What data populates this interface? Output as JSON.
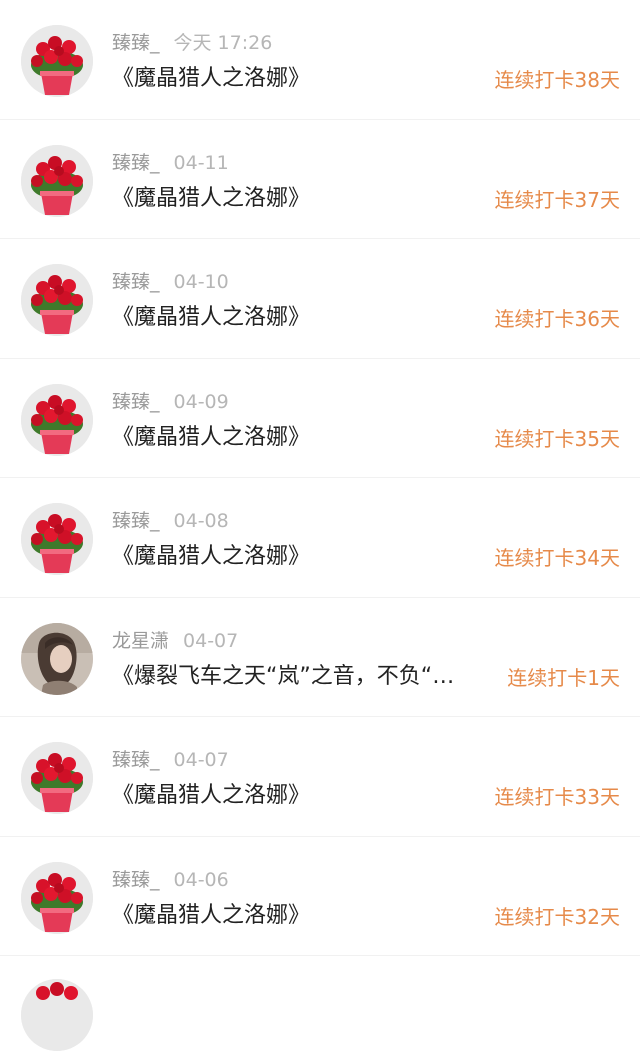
{
  "feed": {
    "items": [
      {
        "avatar": "red-flower-pot",
        "name": "臻臻_",
        "time": "今天 17:26",
        "title": "《魔晶猎人之洛娜》",
        "streak": "连续打卡38天"
      },
      {
        "avatar": "red-flower-pot",
        "name": "臻臻_",
        "time": "04-11",
        "title": "《魔晶猎人之洛娜》",
        "streak": "连续打卡37天"
      },
      {
        "avatar": "red-flower-pot",
        "name": "臻臻_",
        "time": "04-10",
        "title": "《魔晶猎人之洛娜》",
        "streak": "连续打卡36天"
      },
      {
        "avatar": "red-flower-pot",
        "name": "臻臻_",
        "time": "04-09",
        "title": "《魔晶猎人之洛娜》",
        "streak": "连续打卡35天"
      },
      {
        "avatar": "red-flower-pot",
        "name": "臻臻_",
        "time": "04-08",
        "title": "《魔晶猎人之洛娜》",
        "streak": "连续打卡34天"
      },
      {
        "avatar": "person-photo",
        "name": "龙星潇",
        "time": "04-07",
        "title": "《爆裂飞车之天“岚”之音，不负“…",
        "streak": "连续打卡1天"
      },
      {
        "avatar": "red-flower-pot",
        "name": "臻臻_",
        "time": "04-07",
        "title": "《魔晶猎人之洛娜》",
        "streak": "连续打卡33天"
      },
      {
        "avatar": "red-flower-pot",
        "name": "臻臻_",
        "time": "04-06",
        "title": "《魔晶猎人之洛娜》",
        "streak": "连续打卡32天"
      }
    ]
  },
  "colors": {
    "streak": "#e68a4a",
    "title": "#222222",
    "meta": "#9a9a9a",
    "divider": "#f1f1f1"
  }
}
